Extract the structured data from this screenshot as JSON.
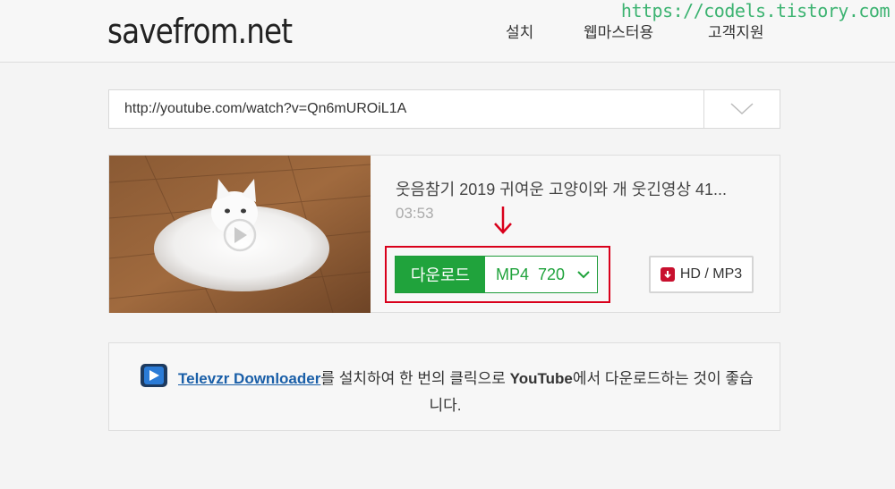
{
  "header": {
    "logo": "savefrom.net",
    "nav": [
      "설치",
      "웹마스터용",
      "고객지원"
    ],
    "watermark": "https://codels.tistory.com"
  },
  "url_bar": {
    "value": "http://youtube.com/watch?v=Qn6mUROiL1A",
    "dropdown_icon": "chevron-down-icon"
  },
  "result": {
    "title": "웃음참기 2019 귀여운 고양이와 개 웃긴영상 41...",
    "duration": "03:53",
    "thumbnail_icon": "play-icon",
    "download_label": "다운로드",
    "format": "MP4",
    "quality": "720",
    "hd_label": "HD / MP3",
    "annotation_arrow": "red-down-arrow",
    "colors": {
      "download_green": "#20a33c",
      "annotation_red": "#d9001b"
    }
  },
  "promo": {
    "link_text": "Televzr Downloader",
    "text1": "를 설치하여 한 번의 클릭으로 ",
    "youtube": "YouTube",
    "text2": "에서 다운로드하는 것이 좋습",
    "text3": "니다."
  }
}
